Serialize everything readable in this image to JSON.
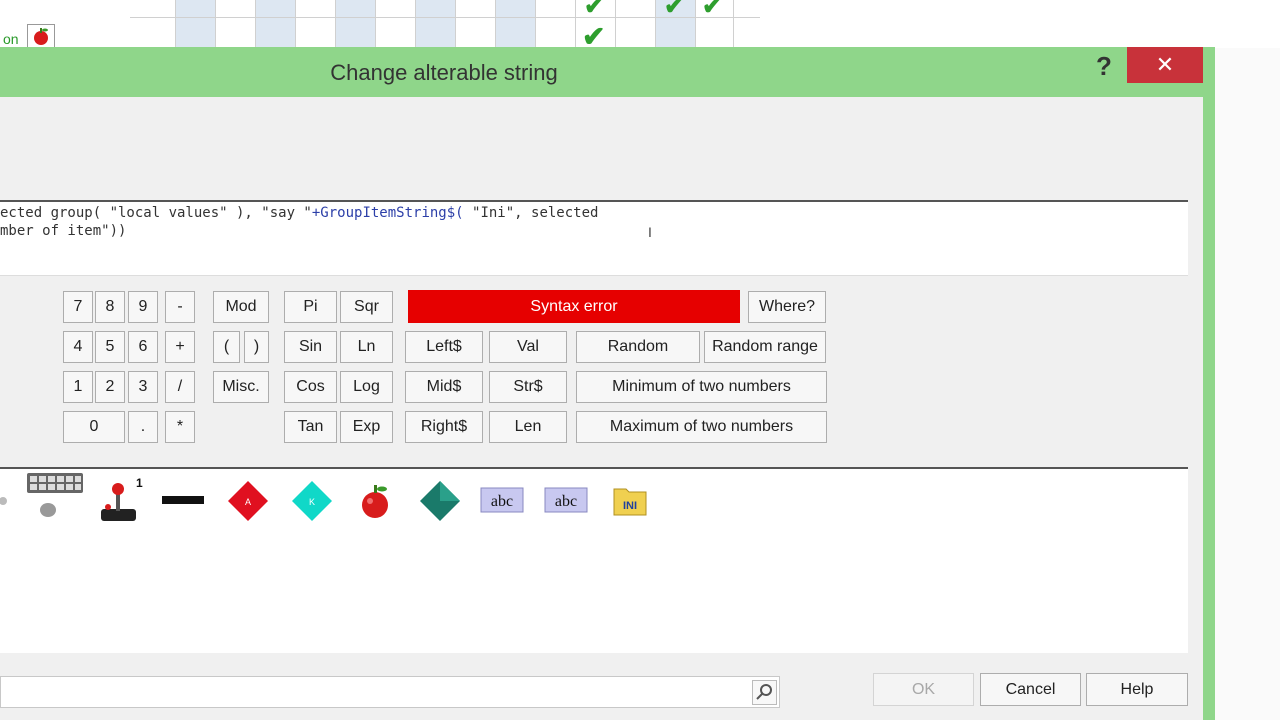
{
  "background": {
    "row_label": "on"
  },
  "dialog": {
    "title": "Change alterable string",
    "help_symbol": "?",
    "close_symbol": "✕"
  },
  "expression": {
    "line1_a": "ected group( \"local values\" ), \"say \"",
    "line1_kw": "+GroupItemString$(",
    "line1_b": " \"Ini\", selected",
    "line2": "mber of item\"))"
  },
  "keypad": {
    "digits": [
      "7",
      "8",
      "9",
      "-",
      "4",
      "5",
      "6",
      "+",
      "1",
      "2",
      "3",
      "/",
      "0",
      ".",
      "*"
    ],
    "mod": "Mod",
    "open_paren": "(",
    "close_paren": ")",
    "misc": "Misc."
  },
  "functions": {
    "pi": "Pi",
    "sqr": "Sqr",
    "sin": "Sin",
    "ln": "Ln",
    "cos": "Cos",
    "log": "Log",
    "tan": "Tan",
    "exp": "Exp",
    "left": "Left$",
    "val": "Val",
    "mid": "Mid$",
    "str": "Str$",
    "right": "Right$",
    "len": "Len",
    "random": "Random",
    "random_range": "Random range",
    "min": "Minimum of two numbers",
    "max": "Maximum of two numbers"
  },
  "status": {
    "text": "Syntax error",
    "color": "#e60000",
    "where_label": "Where?"
  },
  "objects": [
    {
      "name": "keyboard-mouse-icon",
      "badge": ""
    },
    {
      "name": "joystick-icon",
      "badge": "1"
    },
    {
      "name": "line-icon",
      "badge": ""
    },
    {
      "name": "red-diamond-icon",
      "label": "A"
    },
    {
      "name": "cyan-diamond-icon",
      "label": "K"
    },
    {
      "name": "apple-icon"
    },
    {
      "name": "teal-diamond-icon"
    },
    {
      "name": "string-icon",
      "label": "abc"
    },
    {
      "name": "string-icon-2",
      "label": "abc"
    },
    {
      "name": "ini-icon",
      "label": "INI"
    }
  ],
  "footer": {
    "ok_label": "OK",
    "cancel_label": "Cancel",
    "help_label": "Help"
  },
  "colors": {
    "title_bar": "#8fd68a",
    "close": "#c8323a",
    "check": "#2e9e2e"
  }
}
